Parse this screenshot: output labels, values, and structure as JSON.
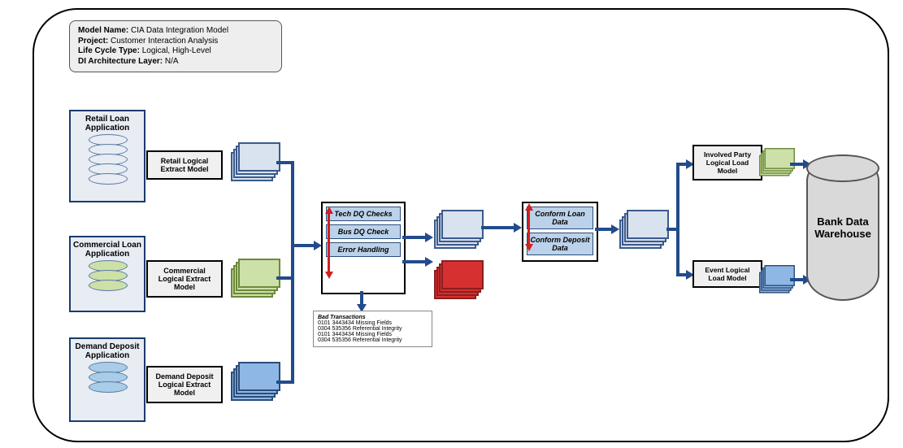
{
  "info": {
    "model_name_label": "Model Name:",
    "model_name": "CIA Data Integration Model",
    "project_label": "Project:",
    "project": "Customer Interaction Analysis",
    "life_cycle_label": "Life Cycle Type:",
    "life_cycle": "Logical, High-Level",
    "di_layer_label": "DI Architecture Layer:",
    "di_layer": "N/A"
  },
  "sources": {
    "retail": {
      "title": "Retail Loan Application",
      "extract": "Retail Logical Extract Model"
    },
    "commercial": {
      "title": "Commercial Loan Application",
      "extract": "Commercial Logical Extract Model"
    },
    "demand": {
      "title": "Demand Deposit Application",
      "extract": "Demand Deposit Logical Extract Model"
    }
  },
  "dq": {
    "tech": "Tech DQ Checks",
    "bus": "Bus DQ Check",
    "err": "Error Handling"
  },
  "conform": {
    "loan": "Conform Loan Data",
    "deposit": "Conform Deposit Data"
  },
  "bad_tx": {
    "header": "Bad Transactions",
    "l1": "0101 3443434 Missing Fields",
    "l2": "0304 535356 Referential Integrity",
    "l3": "0101 3443434 Missing Fields",
    "l4": "0304 535356 Referential Integrity"
  },
  "loads": {
    "party": "Involved Party Logical Load Model",
    "event": "Event Logical Load Model"
  },
  "warehouse": "Bank Data Warehouse"
}
